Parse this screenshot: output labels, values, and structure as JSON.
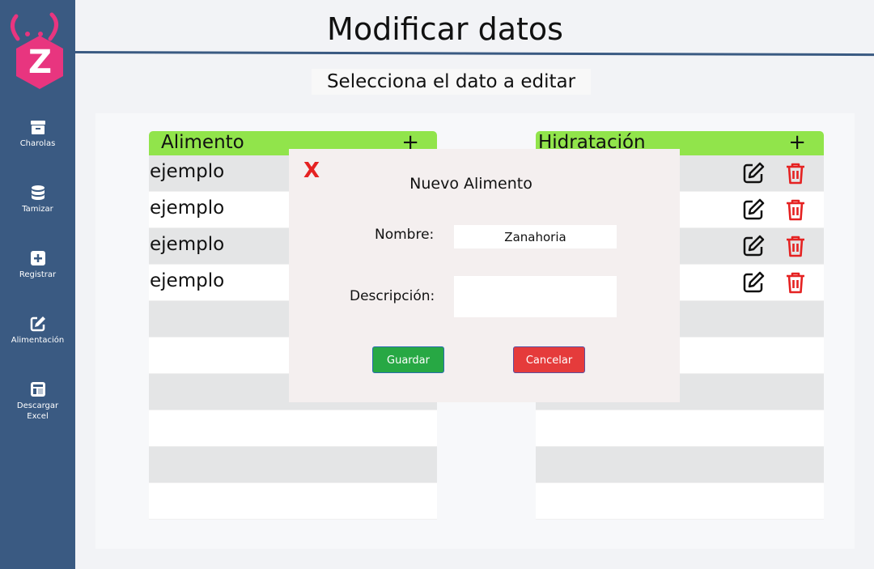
{
  "app": {
    "logo_letter": "Z"
  },
  "sidebar": {
    "items": [
      {
        "label": "Charolas",
        "icon": "archive-box-icon"
      },
      {
        "label": "Tamizar",
        "icon": "database-icon"
      },
      {
        "label": "Registrar",
        "icon": "plus-square-icon"
      },
      {
        "label": "Alimentación",
        "icon": "edit-square-icon"
      },
      {
        "label": "Descargar Excel",
        "icon": "table-layout-icon"
      }
    ]
  },
  "header": {
    "title": "Modificar datos",
    "subtitle": "Selecciona el dato a editar"
  },
  "tables": {
    "left": {
      "header": "Alimento",
      "add_symbol": "+",
      "rows": [
        "ejemplo",
        "ejemplo",
        "ejemplo",
        "ejemplo"
      ]
    },
    "right": {
      "header": "Hidratación",
      "add_symbol": "+"
    }
  },
  "modal": {
    "close_label": "X",
    "title": "Nuevo Alimento",
    "name_label": "Nombre:",
    "name_value": "Zanahoria",
    "description_label": "Descripción:",
    "description_value": "",
    "save_label": "Guardar",
    "cancel_label": "Cancelar"
  },
  "colors": {
    "sidebar": "#3a5a82",
    "table_header": "#91e44b",
    "logo": "#e8357f",
    "delete": "#e52222",
    "save": "#27a844",
    "cancel": "#e53b3b"
  }
}
